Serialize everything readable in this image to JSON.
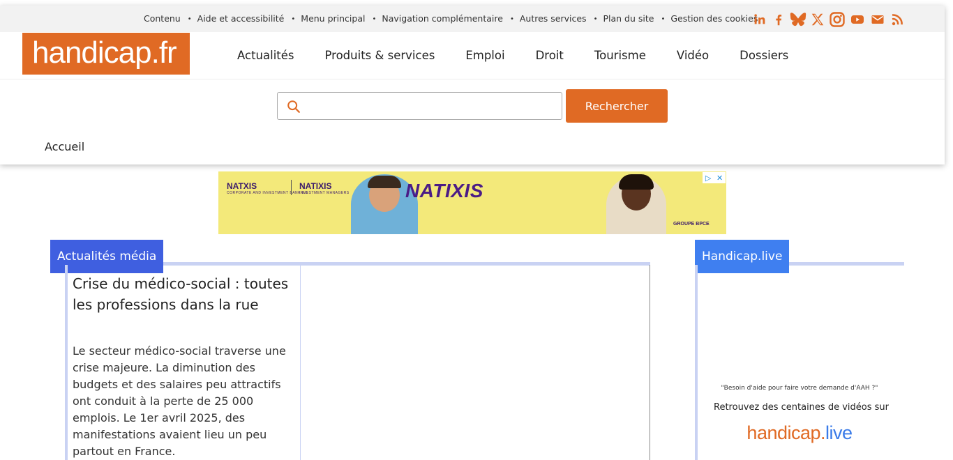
{
  "topbar": {
    "links": [
      "Contenu",
      "Aide et accessibilité",
      "Menu principal",
      "Navigation complémentaire",
      "Autres services",
      "Plan du site",
      "Gestion des cookies"
    ],
    "social_icons": [
      "linkedin-icon",
      "facebook-icon",
      "bluesky-icon",
      "x-icon",
      "instagram-icon",
      "youtube-icon",
      "email-icon",
      "rss-icon"
    ]
  },
  "brand": {
    "logo_text": "handicap.fr",
    "color": "#e06a24"
  },
  "nav": {
    "items": [
      "Actualités",
      "Produits & services",
      "Emploi",
      "Droit",
      "Tourisme",
      "Vidéo",
      "Dossiers"
    ]
  },
  "search": {
    "placeholder": "",
    "value": "",
    "button_label": "Rechercher"
  },
  "breadcrumb": {
    "current": "Accueil"
  },
  "ad": {
    "logo_left": "NATXIS",
    "logo_left_sub": "CORPORATE AND INVESTMENT BANKING",
    "logo_right": "NATIXIS",
    "logo_right_sub": "INVESTMENT MANAGERS",
    "title": "NATIXIS",
    "group": "GROUPE BPCE"
  },
  "media_section": {
    "tab_label": "Actualités média",
    "article_title": "Crise du médico-social : toutes les professions dans la rue",
    "article_desc": "Le secteur médico-social traverse une crise majeure. La diminution des budgets et des salaires peu attractifs ont conduit à la perte de 25 000 emplois. Le 1er avril 2025, des manifestations avaient lieu un peu partout en France."
  },
  "live_section": {
    "tab_label": "Handicap.live",
    "quote": "\"Besoin d'aide pour faire votre demande d'AAH ?\"",
    "promo_text": "Retrouvez des centaines de vidéos sur",
    "logo_main": "handicap",
    "logo_suffix": "live"
  }
}
